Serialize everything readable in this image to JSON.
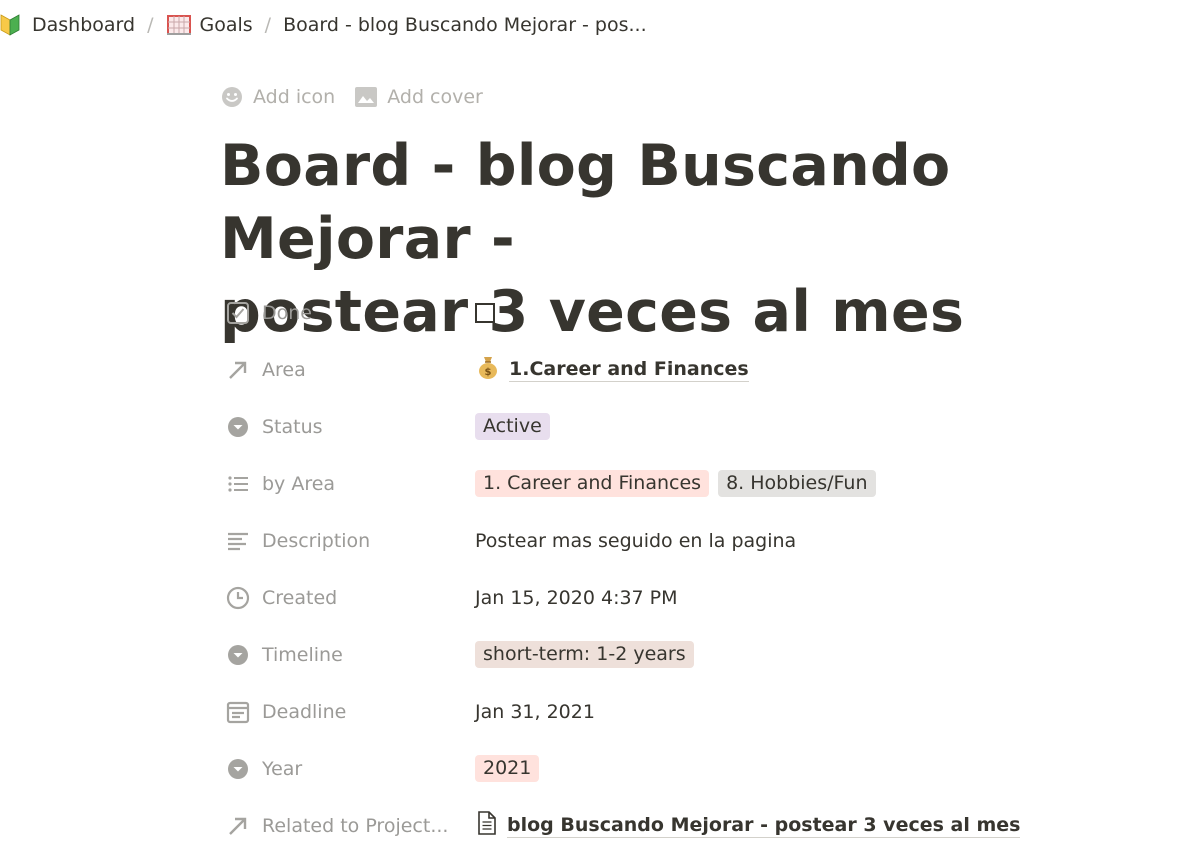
{
  "breadcrumb": {
    "items": [
      {
        "label": "Dashboard",
        "icon": "beginner-badge-icon"
      },
      {
        "label": "Goals",
        "icon": "goal-net-icon"
      },
      {
        "label": "Board - blog Buscando Mejorar - pos..."
      }
    ],
    "separator": "/"
  },
  "page_actions": {
    "add_icon": "Add icon",
    "add_cover": "Add cover"
  },
  "title_line1": "Board - blog Buscando Mejorar -",
  "title_line2": "postear 3 veces al mes",
  "properties": {
    "done": {
      "name": "Done",
      "checked": false
    },
    "area": {
      "name": "Area",
      "value": "1.Career and Finances",
      "icon": "money-bag-icon"
    },
    "status": {
      "name": "Status",
      "value": "Active",
      "color": "#e8deee"
    },
    "by_area": {
      "name": "by Area",
      "tags": [
        "1. Career and Finances",
        "8. Hobbies/Fun"
      ]
    },
    "description": {
      "name": "Description",
      "value": "Postear mas seguido en la pagina"
    },
    "created": {
      "name": "Created",
      "value": "Jan 15, 2020 4:37 PM"
    },
    "timeline": {
      "name": "Timeline",
      "value": "short-term: 1-2 years"
    },
    "deadline": {
      "name": "Deadline",
      "value": "Jan 31, 2021"
    },
    "year": {
      "name": "Year",
      "value": "2021"
    },
    "related": {
      "name": "Related to Project...",
      "value": "blog Buscando Mejorar - postear 3 veces al mes",
      "icon": "page-icon"
    }
  },
  "colors": {
    "text": "#37352f",
    "muted": "#9b9a97",
    "tag_purple": "#e8deee",
    "tag_red": "#ffe2dd",
    "tag_gray": "#e3e2e0",
    "tag_brown": "#eee0da"
  }
}
